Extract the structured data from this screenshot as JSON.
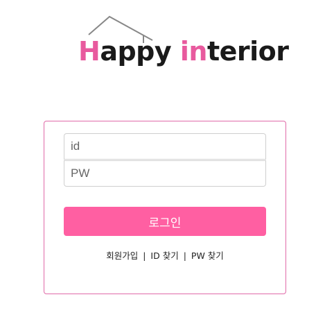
{
  "logo": {
    "part1_initial": "H",
    "part1_rest": "appy ",
    "part2_accent": "in",
    "part2_rest": "terior"
  },
  "form": {
    "id_placeholder": "id",
    "pw_placeholder": "PW",
    "login_label": "로그인"
  },
  "links": {
    "signup": "회원가입",
    "find_id": "ID 찾기",
    "find_pw": "PW 찾기",
    "separator": "|"
  },
  "colors": {
    "accent": "#ff5fa2",
    "box_border": "#e06aa8",
    "logo_pink": "#e85a9e"
  }
}
